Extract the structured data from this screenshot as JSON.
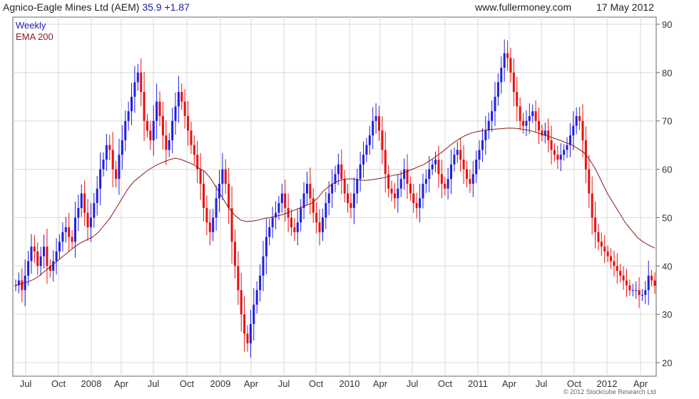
{
  "header": {
    "title": "Agnico-Eagle Mines Ltd (AEM)",
    "price": "35.9",
    "change": "+1.87",
    "site": "www.fullermoney.com",
    "date": "17 May 2012"
  },
  "footer": {
    "copyright": "© 2012 Stockcube Research Ltd"
  },
  "colors": {
    "up": "#1f1fe0",
    "down": "#e81010",
    "ema": "#8b1a1a",
    "grid": "#d9d9d9"
  },
  "chart_data": {
    "type": "line",
    "title": "Agnico-Eagle Mines Ltd (AEM)",
    "grid": true,
    "legend_position": "top-left",
    "x_range": [
      "2007-07",
      "2012-05"
    ],
    "ylim": [
      20,
      90
    ],
    "yticks": [
      20,
      30,
      40,
      50,
      60,
      70,
      80,
      90
    ],
    "xticks": [
      "Jul",
      "Oct",
      "2008",
      "Apr",
      "Jul",
      "Oct",
      "2009",
      "Apr",
      "Jul",
      "Oct",
      "2010",
      "Apr",
      "Jul",
      "Oct",
      "2011",
      "Apr",
      "Jul",
      "Oct",
      "2012",
      "Apr"
    ],
    "series": [
      {
        "name": "Weekly",
        "style": "weekly-bars",
        "closes": [
          36,
          37,
          35,
          38,
          41,
          44,
          43,
          40,
          42,
          44,
          40,
          39,
          41,
          43,
          45,
          47,
          48,
          46,
          45,
          50,
          52,
          55,
          51,
          48,
          50,
          53,
          56,
          60,
          62,
          65,
          64,
          60,
          58,
          63,
          66,
          70,
          72,
          75,
          78,
          80,
          76,
          70,
          68,
          66,
          70,
          74,
          71,
          67,
          64,
          66,
          70,
          73,
          76,
          74,
          71,
          68,
          65,
          63,
          60,
          57,
          52,
          49,
          47,
          50,
          54,
          57,
          60,
          57,
          52,
          45,
          40,
          35,
          30,
          26,
          24,
          28,
          32,
          35,
          38,
          42,
          46,
          48,
          50,
          51,
          53,
          55,
          52,
          50,
          48,
          47,
          49,
          52,
          55,
          57,
          54,
          51,
          49,
          47,
          50,
          53,
          55,
          57,
          59,
          61,
          58,
          55,
          53,
          52,
          55,
          58,
          61,
          63,
          65,
          67,
          70,
          71,
          68,
          64,
          59,
          56,
          55,
          54,
          56,
          58,
          60,
          57,
          55,
          53,
          52,
          54,
          57,
          58,
          60,
          61,
          62,
          59,
          57,
          56,
          58,
          61,
          63,
          64,
          62,
          60,
          58,
          57,
          59,
          62,
          64,
          66,
          68,
          70,
          72,
          75,
          78,
          81,
          84,
          83,
          80,
          76,
          73,
          70,
          69,
          70,
          71,
          72,
          70,
          68,
          67,
          68,
          66,
          64,
          63,
          62,
          63,
          64,
          65,
          67,
          69,
          71,
          70,
          66,
          60,
          55,
          50,
          47,
          45,
          44,
          43,
          42,
          41,
          40,
          39,
          38,
          37,
          36,
          35,
          35,
          35,
          34,
          34,
          35,
          38,
          37,
          35.9
        ]
      },
      {
        "name": "EMA 200",
        "style": "line",
        "values": [
          36,
          36.3,
          36.7,
          37.2,
          38,
          39,
          40,
          41,
          42,
          43,
          44,
          44.8,
          45.4,
          46,
          47,
          48.5,
          50,
          52,
          54,
          56,
          57.5,
          58.5,
          59.5,
          60.3,
          61,
          61.5,
          62,
          62.3,
          62,
          61.5,
          61,
          60.2,
          59.5,
          58,
          56,
          54,
          52,
          50.5,
          49.5,
          49.2,
          49.3,
          49.5,
          49.8,
          50,
          50.3,
          50.6,
          51,
          51.5,
          52,
          52.5,
          53,
          54,
          55.5,
          56.5,
          57.3,
          57.8,
          58,
          58,
          57.8,
          57.7,
          57.8,
          58,
          58.2,
          58.5,
          58.8,
          59,
          59.5,
          60,
          60.5,
          61,
          61.8,
          62.6,
          63.5,
          64.5,
          65.5,
          66.3,
          67,
          67.5,
          67.8,
          68,
          68.2,
          68.3,
          68.4,
          68.5,
          68.5,
          68.4,
          68.2,
          68,
          67.6,
          67.2,
          66.8,
          66.4,
          66,
          65.5,
          65,
          64.3,
          63.5,
          62,
          60,
          57.5,
          55,
          53,
          51,
          49,
          47.5,
          46,
          45,
          44.3,
          43.7
        ]
      }
    ]
  }
}
